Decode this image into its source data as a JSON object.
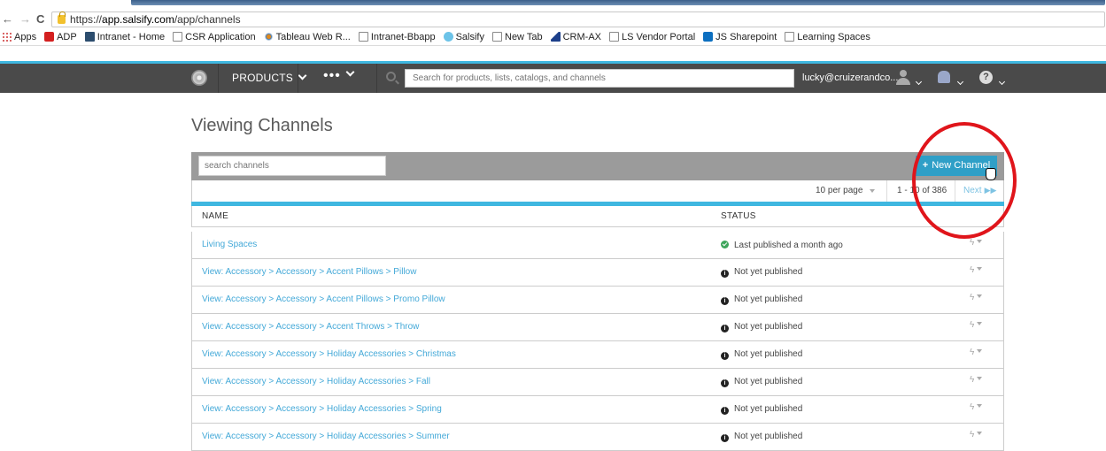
{
  "browser": {
    "url_prefix": "https://",
    "url_host": "app.salsify.com",
    "url_path": "/app/channels",
    "bookmarks": [
      {
        "label": "Apps",
        "icon": "apps-grid-icon"
      },
      {
        "label": "ADP",
        "icon": "adp-icon"
      },
      {
        "label": "Intranet - Home",
        "icon": "ls-icon"
      },
      {
        "label": "CSR Application",
        "icon": "page-icon"
      },
      {
        "label": "Tableau Web R...",
        "icon": "tableau-icon"
      },
      {
        "label": "Intranet-Bbapp",
        "icon": "page-icon"
      },
      {
        "label": "Salsify",
        "icon": "salsify-icon"
      },
      {
        "label": "New Tab",
        "icon": "page-icon"
      },
      {
        "label": "CRM-AX",
        "icon": "crm-icon"
      },
      {
        "label": "LS Vendor Portal",
        "icon": "page-icon"
      },
      {
        "label": "JS Sharepoint",
        "icon": "sharepoint-icon"
      },
      {
        "label": "Learning Spaces",
        "icon": "page-icon"
      }
    ]
  },
  "header": {
    "products_label": "PRODUCTS",
    "more_label": "•••",
    "search_placeholder": "Search for products, lists, catalogs, and channels",
    "user_email": "lucky@cruizerandco....",
    "help_label": "?"
  },
  "page": {
    "title": "Viewing Channels",
    "search_placeholder": "search channels",
    "new_button": {
      "plus": "+",
      "label": "New Channel"
    },
    "pager": {
      "per_page": "10 per page",
      "range": "1 - 10 of 386",
      "next": "Next"
    },
    "columns": {
      "name": "NAME",
      "status": "STATUS"
    },
    "rows": [
      {
        "name": "Living Spaces",
        "status": "Last published a month ago",
        "status_type": "published"
      },
      {
        "name": "View: Accessory > Accessory > Accent Pillows > Pillow",
        "status": "Not yet published",
        "status_type": "unpublished"
      },
      {
        "name": "View: Accessory > Accessory > Accent Pillows > Promo Pillow",
        "status": "Not yet published",
        "status_type": "unpublished"
      },
      {
        "name": "View: Accessory > Accessory > Accent Throws > Throw",
        "status": "Not yet published",
        "status_type": "unpublished"
      },
      {
        "name": "View: Accessory > Accessory > Holiday Accessories > Christmas",
        "status": "Not yet published",
        "status_type": "unpublished"
      },
      {
        "name": "View: Accessory > Accessory > Holiday Accessories > Fall",
        "status": "Not yet published",
        "status_type": "unpublished"
      },
      {
        "name": "View: Accessory > Accessory > Holiday Accessories > Spring",
        "status": "Not yet published",
        "status_type": "unpublished"
      },
      {
        "name": "View: Accessory > Accessory > Holiday Accessories > Summer",
        "status": "Not yet published",
        "status_type": "unpublished"
      }
    ]
  },
  "colors": {
    "accent": "#3fb7e0",
    "button": "#2f9fc7",
    "link": "#44a9d8",
    "nav_bg": "#4a4a4a",
    "annotation_ring": "#e0151b"
  }
}
